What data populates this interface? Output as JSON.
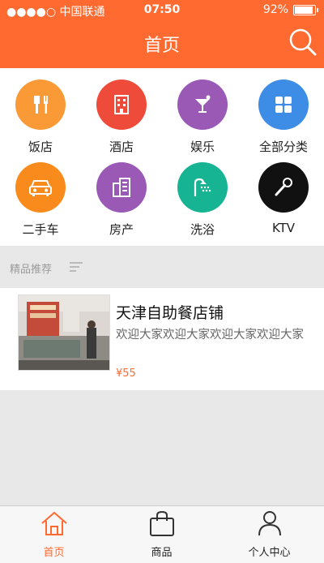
{
  "status_bar": {
    "carrier": "●●●●○ 中国联通",
    "time": "07:50",
    "battery": "92%"
  },
  "nav": {
    "title": "首页"
  },
  "categories": [
    {
      "label": "饭店",
      "icon": "fork-knife-icon",
      "color": "#f99a37"
    },
    {
      "label": "酒店",
      "icon": "hotel-building-icon",
      "color": "#ef4b3b"
    },
    {
      "label": "娱乐",
      "icon": "cocktail-icon",
      "color": "#9b59b6"
    },
    {
      "label": "全部分类",
      "icon": "grid-icon",
      "color": "#3d8ce6"
    },
    {
      "label": "二手车",
      "icon": "car-icon",
      "color": "#f98b1c"
    },
    {
      "label": "房产",
      "icon": "building-icon",
      "color": "#9b59b6"
    },
    {
      "label": "洗浴",
      "icon": "shower-icon",
      "color": "#16b493"
    },
    {
      "label": "KTV",
      "icon": "microphone-icon",
      "color": "#111111"
    }
  ],
  "section": {
    "title": "精品推荐"
  },
  "listing": {
    "title": "天津自助餐店铺",
    "description": "欢迎大家欢迎大家欢迎大家欢迎大家",
    "price": "¥55"
  },
  "tabs": [
    {
      "label": "首页",
      "icon": "home-icon"
    },
    {
      "label": "商品",
      "icon": "shopping-bag-icon"
    },
    {
      "label": "个人中心",
      "icon": "person-icon"
    }
  ],
  "colors": {
    "accent": "#ff6a30",
    "background": "#e8e8e8"
  }
}
